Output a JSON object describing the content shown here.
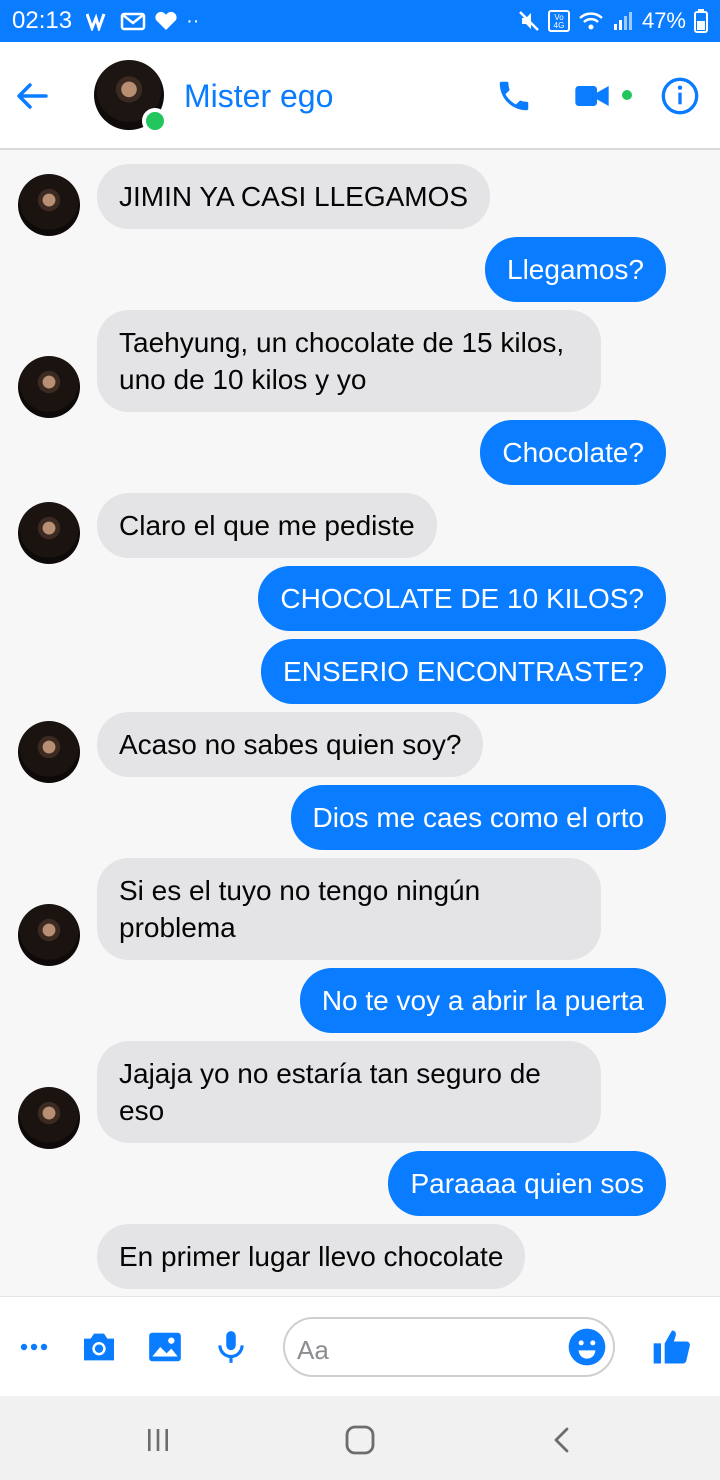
{
  "status_bar": {
    "time": "02:13",
    "battery": "47%"
  },
  "header": {
    "contact_name": "Mister ego"
  },
  "colors": {
    "accent": "#0a7cff",
    "incoming_bubble": "#e4e4e6",
    "online": "#22c55e"
  },
  "messages": [
    {
      "direction": "in",
      "text": "JIMIN YA CASI LLEGAMOS"
    },
    {
      "direction": "out",
      "text": "Llegamos?"
    },
    {
      "direction": "in",
      "text": "Taehyung, un chocolate de 15 kilos, uno de 10 kilos y yo"
    },
    {
      "direction": "out",
      "text": "Chocolate?"
    },
    {
      "direction": "in",
      "text": "Claro el que me pediste"
    },
    {
      "direction": "out",
      "text": "CHOCOLATE DE 10 KILOS?"
    },
    {
      "direction": "out",
      "text": "ENSERIO ENCONTRASTE?"
    },
    {
      "direction": "in",
      "text": "Acaso no sabes quien soy?"
    },
    {
      "direction": "out",
      "text": "Dios me caes como el orto"
    },
    {
      "direction": "in",
      "text": "Si es el tuyo no tengo ningún problema"
    },
    {
      "direction": "out",
      "text": "No te voy a abrir la puerta"
    },
    {
      "direction": "in",
      "text": "Jajaja yo no estaría tan seguro de eso"
    },
    {
      "direction": "out",
      "text": "Paraaaa quien sos"
    },
    {
      "direction": "in",
      "text": "En primer lugar llevo chocolate"
    }
  ],
  "composer": {
    "placeholder": "Aa"
  },
  "icons": [
    "back-arrow-icon",
    "phone-icon",
    "video-camera-icon",
    "info-icon",
    "more-icon",
    "camera-icon",
    "gallery-icon",
    "microphone-icon",
    "emoji-icon",
    "like-icon",
    "recent-apps-icon",
    "home-icon",
    "back-icon"
  ]
}
